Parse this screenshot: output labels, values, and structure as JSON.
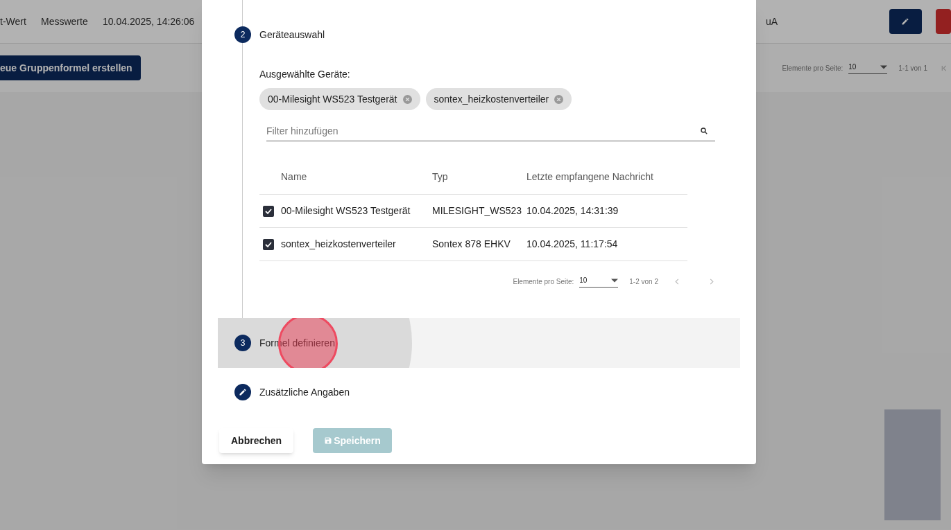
{
  "background": {
    "header_cells": [
      "t-Wert",
      "Messwerte",
      "10.04.2025, 14:26:06",
      "uA"
    ],
    "create_button": "eue Gruppenformel erstellen",
    "paginator": {
      "label": "Elemente pro Seite:",
      "page_size": "10",
      "range": "1-1 von 1"
    }
  },
  "dialog": {
    "step_device": {
      "number": "2",
      "title": "Geräteauswahl"
    },
    "selected_label": "Ausgewählte Geräte:",
    "chips": [
      "00-Milesight WS523 Testgerät",
      "sontex_heizkostenverteiler"
    ],
    "filter": {
      "placeholder": "Filter hinzufügen"
    },
    "table": {
      "columns": [
        "Name",
        "Typ",
        "Letzte empfangene Nachricht"
      ],
      "rows": [
        {
          "checked": true,
          "name": "00-Milesight WS523 Testgerät",
          "type": "MILESIGHT_WS523",
          "last": "10.04.2025, 14:31:39"
        },
        {
          "checked": true,
          "name": "sontex_heizkostenverteiler",
          "type": "Sontex 878 EHKV",
          "last": "10.04.2025, 11:17:54"
        }
      ]
    },
    "paginator": {
      "label": "Elemente pro Seite:",
      "page_size": "10",
      "range": "1-2 von 2"
    },
    "later_steps": [
      {
        "kind": "number",
        "number": "3",
        "title": "Formel definieren",
        "pressed": true
      },
      {
        "kind": "edit",
        "title": "Zusätzliche Angaben",
        "pressed": false
      }
    ],
    "cancel_button": "Abbrechen",
    "save_button": {
      "label": "Speichern",
      "disabled": true
    }
  }
}
